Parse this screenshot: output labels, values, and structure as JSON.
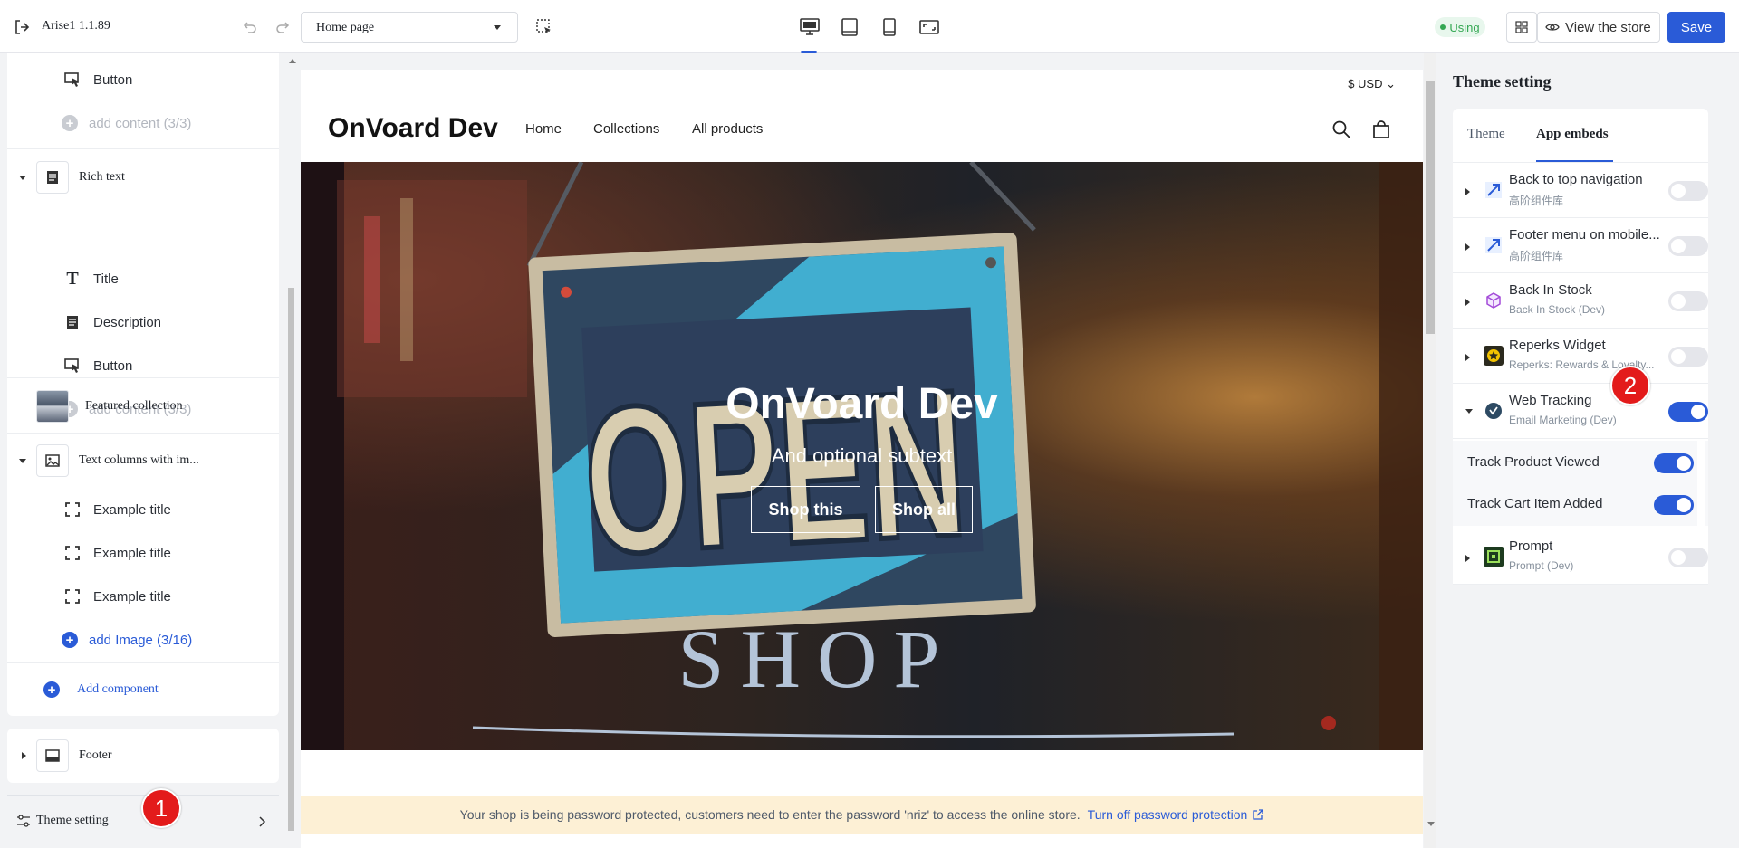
{
  "topbar": {
    "app_name": "Arise1 1.1.89",
    "page_select": "Home page",
    "using_badge": "Using",
    "view_store": "View the store",
    "save": "Save"
  },
  "left_panel": {
    "items": [
      {
        "label": "Button",
        "icon": "button-cursor-icon"
      },
      {
        "label": "add content (3/3)",
        "icon": "plus-icon"
      },
      {
        "label": "Rich text",
        "icon": "document-icon"
      },
      {
        "label": "Title",
        "icon": "text-t-icon"
      },
      {
        "label": "Description",
        "icon": "document-icon"
      },
      {
        "label": "Button",
        "icon": "button-cursor-icon"
      },
      {
        "label": "add content (3/3)",
        "icon": "plus-icon"
      },
      {
        "label": "Featured collection",
        "icon": "image-thumb"
      },
      {
        "label": "Text columns with im...",
        "icon": "image-icon"
      },
      {
        "label": "Example title",
        "icon": "frame-icon"
      },
      {
        "label": "Example title",
        "icon": "frame-icon"
      },
      {
        "label": "Example title",
        "icon": "frame-icon"
      },
      {
        "label": "add Image (3/16)",
        "icon": "plus-icon"
      },
      {
        "label": "Add component",
        "icon": "plus-icon"
      }
    ],
    "footer": "Footer",
    "theme_setting": "Theme setting"
  },
  "markers": {
    "one": "1",
    "two": "2"
  },
  "preview": {
    "currency": "$ USD",
    "brand": "OnVoard Dev",
    "nav": [
      "Home",
      "Collections",
      "All products"
    ],
    "hero_title": "OnVoard Dev",
    "hero_subtitle": "And optional subtext",
    "hero_buttons": [
      "Shop this",
      "Shop all"
    ],
    "sign_text": "OPEN",
    "window_text": "SHOP",
    "password_notice": "Your shop is being password protected, customers need to enter the password 'nriz' to access the online store.",
    "password_link": "Turn off password protection"
  },
  "right_panel": {
    "title": "Theme setting",
    "tabs": [
      "Theme",
      "App embeds"
    ],
    "active_tab": "App embeds",
    "embeds": [
      {
        "name": "Back to top navigation",
        "sub": "高阶组件库",
        "on": false
      },
      {
        "name": "Footer menu on mobile...",
        "sub": "高阶组件库",
        "on": false
      },
      {
        "name": "Back In Stock",
        "sub": "Back In Stock (Dev)",
        "on": false
      },
      {
        "name": "Reperks Widget",
        "sub": "Reperks: Rewards & Loyalty...",
        "on": false
      },
      {
        "name": "Web Tracking",
        "sub": "Email Marketing (Dev)",
        "on": true
      },
      {
        "name": "Prompt",
        "sub": "Prompt (Dev)",
        "on": false
      }
    ],
    "web_tracking_settings": [
      {
        "label": "Track Product Viewed",
        "on": true
      },
      {
        "label": "Track Cart Item Added",
        "on": true
      }
    ]
  },
  "colors": {
    "accent": "#2a5bd7",
    "marker": "#e31b1b",
    "success": "#34a853",
    "notice_bg": "#fdf0d5"
  }
}
